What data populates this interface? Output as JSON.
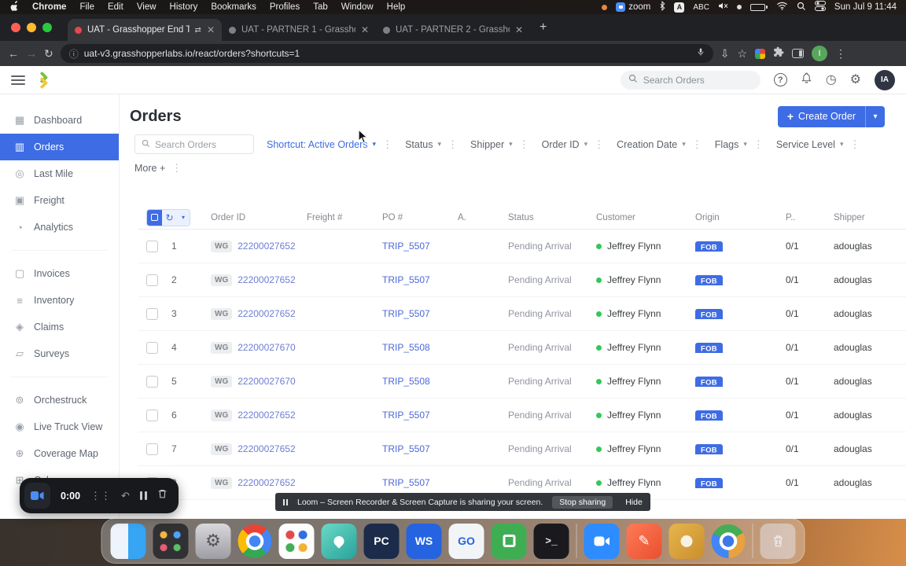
{
  "menubar": {
    "items": [
      "Chrome",
      "File",
      "Edit",
      "View",
      "History",
      "Bookmarks",
      "Profiles",
      "Tab",
      "Window",
      "Help"
    ],
    "zoom_label": "zoom",
    "input_a": "A",
    "input_abc": "ABC",
    "clock": "Sun Jul 9 11:44"
  },
  "browser": {
    "tabs": [
      {
        "title": "UAT - Grasshopper End To",
        "active": true,
        "recording": true
      },
      {
        "title": "UAT - PARTNER 1 - Grasshopp",
        "active": false
      },
      {
        "title": "UAT - PARTNER 2 - Grasshopp",
        "active": false
      }
    ],
    "url": "uat-v3.grasshopperlabs.io/react/orders?shortcuts=1",
    "profile_initial": "I"
  },
  "app": {
    "topbar": {
      "search_placeholder": "Search Orders",
      "help": "?",
      "avatar": "IA"
    },
    "sidebar": {
      "group1": [
        {
          "label": "Dashboard",
          "icon": "grid-icon"
        },
        {
          "label": "Orders",
          "icon": "orders-icon",
          "active": true
        },
        {
          "label": "Last Mile",
          "icon": "last-mile-icon"
        },
        {
          "label": "Freight",
          "icon": "freight-icon"
        },
        {
          "label": "Analytics",
          "icon": "analytics-icon"
        }
      ],
      "group2": [
        {
          "label": "Invoices",
          "icon": "invoices-icon"
        },
        {
          "label": "Inventory",
          "icon": "inventory-icon"
        },
        {
          "label": "Claims",
          "icon": "claims-icon"
        },
        {
          "label": "Surveys",
          "icon": "surveys-icon"
        }
      ],
      "group3": [
        {
          "label": "Orchestruck",
          "icon": "orchestruck-icon"
        },
        {
          "label": "Live Truck View",
          "icon": "live-truck-icon"
        },
        {
          "label": "Coverage Map",
          "icon": "coverage-icon"
        },
        {
          "label": "Calc",
          "icon": "calc-icon"
        }
      ]
    },
    "page": {
      "title": "Orders",
      "create_label": "Create Order",
      "filters": {
        "search_placeholder": "Search Orders",
        "shortcut_label": "Shortcut: Active Orders",
        "chips": [
          "Status",
          "Shipper",
          "Order ID",
          "Creation Date",
          "Flags",
          "Service Level"
        ],
        "more_label": "More +"
      },
      "table": {
        "columns": [
          "Order ID",
          "Freight #",
          "PO #",
          "A.",
          "Status",
          "Customer",
          "Origin",
          "P..",
          "Shipper"
        ],
        "rows": [
          {
            "num": "1",
            "badge": "WG",
            "order_id": "22200027652",
            "po": "TRIP_5507",
            "status": "Pending Arrival",
            "customer": "Jeffrey Flynn",
            "origin": "FOB",
            "p": "0/1",
            "shipper": "adouglas"
          },
          {
            "num": "2",
            "badge": "WG",
            "order_id": "22200027652",
            "po": "TRIP_5507",
            "status": "Pending Arrival",
            "customer": "Jeffrey Flynn",
            "origin": "FOB",
            "p": "0/1",
            "shipper": "adouglas"
          },
          {
            "num": "3",
            "badge": "WG",
            "order_id": "22200027652",
            "po": "TRIP_5507",
            "status": "Pending Arrival",
            "customer": "Jeffrey Flynn",
            "origin": "FOB",
            "p": "0/1",
            "shipper": "adouglas"
          },
          {
            "num": "4",
            "badge": "WG",
            "order_id": "22200027670",
            "po": "TRIP_5508",
            "status": "Pending Arrival",
            "customer": "Jeffrey Flynn",
            "origin": "FOB",
            "p": "0/1",
            "shipper": "adouglas"
          },
          {
            "num": "5",
            "badge": "WG",
            "order_id": "22200027670",
            "po": "TRIP_5508",
            "status": "Pending Arrival",
            "customer": "Jeffrey Flynn",
            "origin": "FOB",
            "p": "0/1",
            "shipper": "adouglas"
          },
          {
            "num": "6",
            "badge": "WG",
            "order_id": "22200027652",
            "po": "TRIP_5507",
            "status": "Pending Arrival",
            "customer": "Jeffrey Flynn",
            "origin": "FOB",
            "p": "0/1",
            "shipper": "adouglas"
          },
          {
            "num": "7",
            "badge": "WG",
            "order_id": "22200027652",
            "po": "TRIP_5507",
            "status": "Pending Arrival",
            "customer": "Jeffrey Flynn",
            "origin": "FOB",
            "p": "0/1",
            "shipper": "adouglas"
          },
          {
            "num": "8",
            "badge": "WG",
            "order_id": "22200027652",
            "po": "TRIP_5507",
            "status": "Pending Arrival",
            "customer": "Jeffrey Flynn",
            "origin": "FOB",
            "p": "0/1",
            "shipper": "adouglas"
          }
        ]
      }
    }
  },
  "loom": {
    "timer": "0:00",
    "banner_text": "Loom – Screen Recorder & Screen Capture is sharing your screen.",
    "stop_label": "Stop sharing",
    "hide_label": "Hide"
  },
  "dock": {
    "pc": "PC",
    "ws": "WS",
    "go": "GO",
    "terminal": ">_"
  },
  "colors": {
    "accent_blue": "#3e6ce4",
    "status_green": "#34c759",
    "link_indigo": "#6d7dd3"
  }
}
